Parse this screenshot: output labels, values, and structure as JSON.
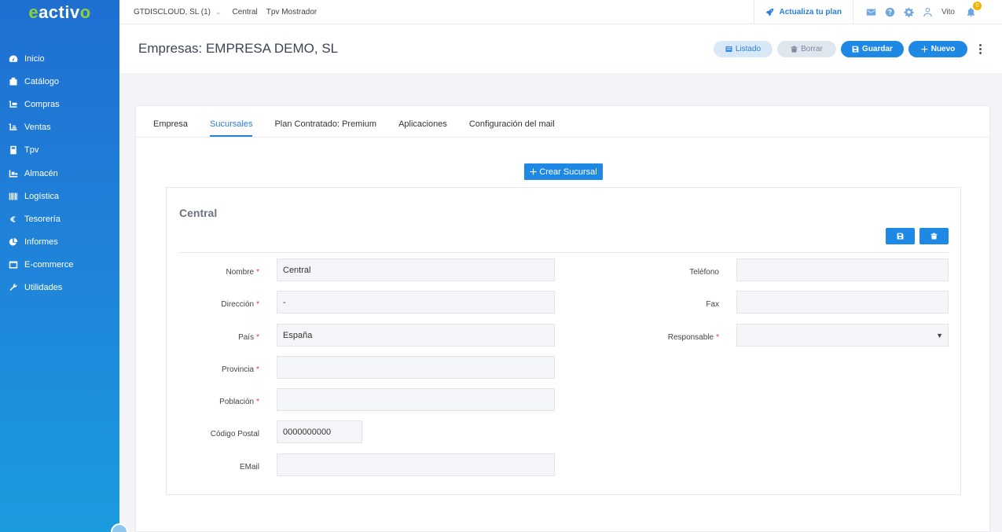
{
  "logo": {
    "part1": "e",
    "part2": "activ",
    "part3": "o"
  },
  "sidebar": {
    "items": [
      {
        "label": "Inicio",
        "icon": "dashboard-icon"
      },
      {
        "label": "Catálogo",
        "icon": "catalog-icon"
      },
      {
        "label": "Compras",
        "icon": "cart-icon"
      },
      {
        "label": "Ventas",
        "icon": "sales-icon"
      },
      {
        "label": "Tpv",
        "icon": "pos-icon"
      },
      {
        "label": "Almacén",
        "icon": "warehouse-icon"
      },
      {
        "label": "Logística",
        "icon": "barcode-icon"
      },
      {
        "label": "Tesorería",
        "icon": "euro-icon"
      },
      {
        "label": "Informes",
        "icon": "pie-chart-icon"
      },
      {
        "label": "E-commerce",
        "icon": "ecommerce-icon"
      },
      {
        "label": "Utilidades",
        "icon": "wrench-icon"
      }
    ]
  },
  "topbar": {
    "company": "GTDISCLOUD, SL (1)",
    "store": "Central",
    "pos": "Tpv Mostrador",
    "upgrade": "Actualiza tu plan",
    "user": "Vito",
    "notifications": "0"
  },
  "header": {
    "title": "Empresas: EMPRESA DEMO, SL",
    "btn_list": "Listado",
    "btn_delete": "Borrar",
    "btn_save": "Guardar",
    "btn_new": "Nuevo"
  },
  "tabs": [
    "Empresa",
    "Sucursales",
    "Plan Contratado: Premium",
    "Aplicaciones",
    "Configuración del mail"
  ],
  "create_branch": "Crear Sucursal",
  "branch": {
    "title": "Central",
    "labels": {
      "nombre": "Nombre",
      "direccion": "Dirección",
      "pais": "País",
      "provincia": "Provincia",
      "poblacion": "Población",
      "codigo_postal": "Código Postal",
      "email": "EMail",
      "telefono": "Teléfono",
      "fax": "Fax",
      "responsable": "Responsable"
    },
    "required_mark": "*",
    "values": {
      "nombre": "Central",
      "direccion": "-",
      "pais": "España",
      "provincia": "",
      "poblacion": "",
      "codigo_postal": "0000000000",
      "email": "",
      "telefono": "",
      "fax": "",
      "responsable": ""
    }
  },
  "colors": {
    "accent": "#1e88e5",
    "sidebar": "#1f7ad6",
    "logo_green": "#8bd13b"
  }
}
